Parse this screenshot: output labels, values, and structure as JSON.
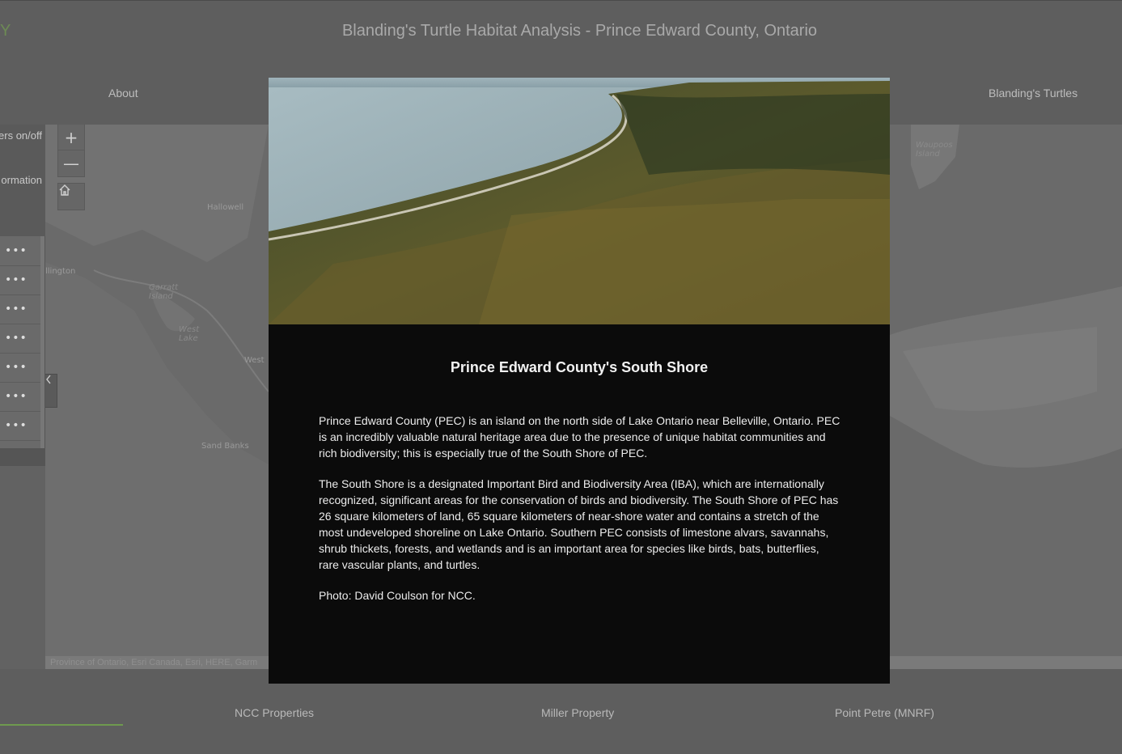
{
  "header": {
    "logo_text": "Y",
    "title": "Blanding's Turtle Habitat Analysis - Prince Edward County, Ontario",
    "nav": [
      "About",
      "Blanding's Turtles"
    ]
  },
  "left_panel": {
    "layers_toggle_label": "ers on/off",
    "information_label": "ormation",
    "row_menu": "•••"
  },
  "map": {
    "zoom_in_label": "+",
    "zoom_out_label": "—",
    "labels": {
      "hallowell": "Hallowell",
      "wellington": "llington",
      "garratt_island": "Garratt Island",
      "west_lake": "West Lake",
      "west": "West",
      "sand_banks": "Sand Banks",
      "waupoos_island": "Waupoos Island"
    },
    "attribution": "Province of Ontario, Esri Canada, Esri, HERE, Garm"
  },
  "bottom_tabs": [
    "NCC Properties",
    "Miller Property",
    "Point Petre (MNRF)"
  ],
  "modal": {
    "title": "Prince Edward County's South Shore",
    "paragraphs": [
      "Prince Edward County (PEC) is an island on the north side of Lake Ontario near Belleville, Ontario. PEC is an incredibly valuable natural heritage area due to the presence of unique habitat communities and rich biodiversity; this is especially true of the South Shore of PEC.",
      "The South Shore is a designated Important Bird and Biodiversity Area (IBA), which are internationally recognized, significant areas for the conservation of birds and biodiversity. The South Shore of PEC has 26 square kilometers of land, 65 square kilometers of near-shore water and contains a stretch of the most undeveloped shoreline on Lake Ontario. Southern PEC consists of limestone alvars, savannahs, shrub thickets, forests, and wetlands and is an important area for species like birds, bats, butterflies, rare vascular plants, and turtles.",
      "Photo: David Coulson for NCC."
    ]
  },
  "colors": {
    "accent": "#6f9a4f",
    "modal_bg": "#0b0b0b",
    "header_bg": "#5e5e5e"
  }
}
